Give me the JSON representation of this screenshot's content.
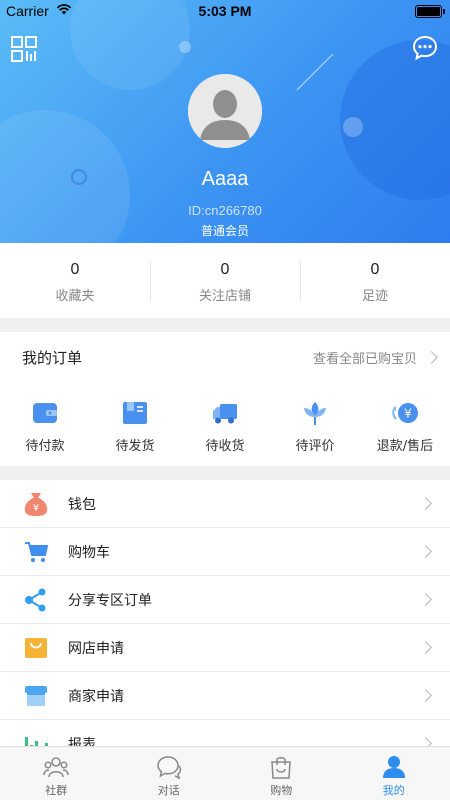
{
  "status_bar": {
    "carrier": "Carrier",
    "time": "5:03 PM"
  },
  "profile": {
    "username": "Aaaa",
    "user_id": "ID:cn266780",
    "member_level": "普通会员"
  },
  "stats": [
    {
      "value": "0",
      "label": "收藏夹"
    },
    {
      "value": "0",
      "label": "关注店铺"
    },
    {
      "value": "0",
      "label": "足迹"
    }
  ],
  "orders": {
    "title": "我的订单",
    "view_all": "查看全部已购宝贝",
    "items": [
      {
        "label": "待付款",
        "icon": "wallet-icon"
      },
      {
        "label": "待发货",
        "icon": "box-icon"
      },
      {
        "label": "待收货",
        "icon": "truck-icon"
      },
      {
        "label": "待评价",
        "icon": "flower-icon"
      },
      {
        "label": "退款/售后",
        "icon": "refund-icon"
      }
    ]
  },
  "menu": [
    {
      "label": "钱包",
      "icon": "money-bag-icon"
    },
    {
      "label": "购物车",
      "icon": "cart-icon"
    },
    {
      "label": "分享专区订单",
      "icon": "share-icon"
    },
    {
      "label": "网店申请",
      "icon": "shop-bag-icon"
    },
    {
      "label": "商家申请",
      "icon": "store-icon"
    },
    {
      "label": "报表",
      "icon": "bar-chart-icon"
    }
  ],
  "tabbar": [
    {
      "label": "社群",
      "icon": "community-icon"
    },
    {
      "label": "对话",
      "icon": "chat-icon"
    },
    {
      "label": "购物",
      "icon": "shopping-bag-icon"
    },
    {
      "label": "我的",
      "icon": "user-icon",
      "active": true
    }
  ],
  "colors": {
    "accent": "#2f8df0",
    "header_start": "#5bbcf7",
    "header_end": "#2f7cf0"
  }
}
